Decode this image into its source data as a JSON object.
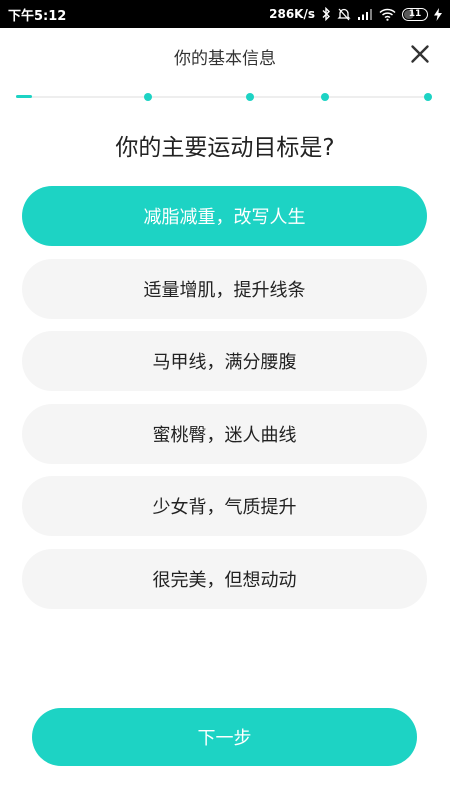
{
  "status_bar": {
    "time": "下午5:12",
    "network_speed": "286K/s",
    "battery_level": "11"
  },
  "header": {
    "title": "你的基本信息",
    "close_icon": "close-icon"
  },
  "progress": {
    "total_steps": 5,
    "current_step": 1
  },
  "question": "你的主要运动目标是?",
  "options": [
    {
      "label": "减脂减重，改写人生",
      "selected": true
    },
    {
      "label": "适量增肌，提升线条",
      "selected": false
    },
    {
      "label": "马甲线，满分腰腹",
      "selected": false
    },
    {
      "label": "蜜桃臀，迷人曲线",
      "selected": false
    },
    {
      "label": "少女背，气质提升",
      "selected": false
    },
    {
      "label": "很完美，但想动动",
      "selected": false
    }
  ],
  "next_button": {
    "label": "下一步"
  },
  "colors": {
    "accent": "#1dd3c4",
    "option_bg": "#f5f5f5",
    "text": "#222222"
  }
}
